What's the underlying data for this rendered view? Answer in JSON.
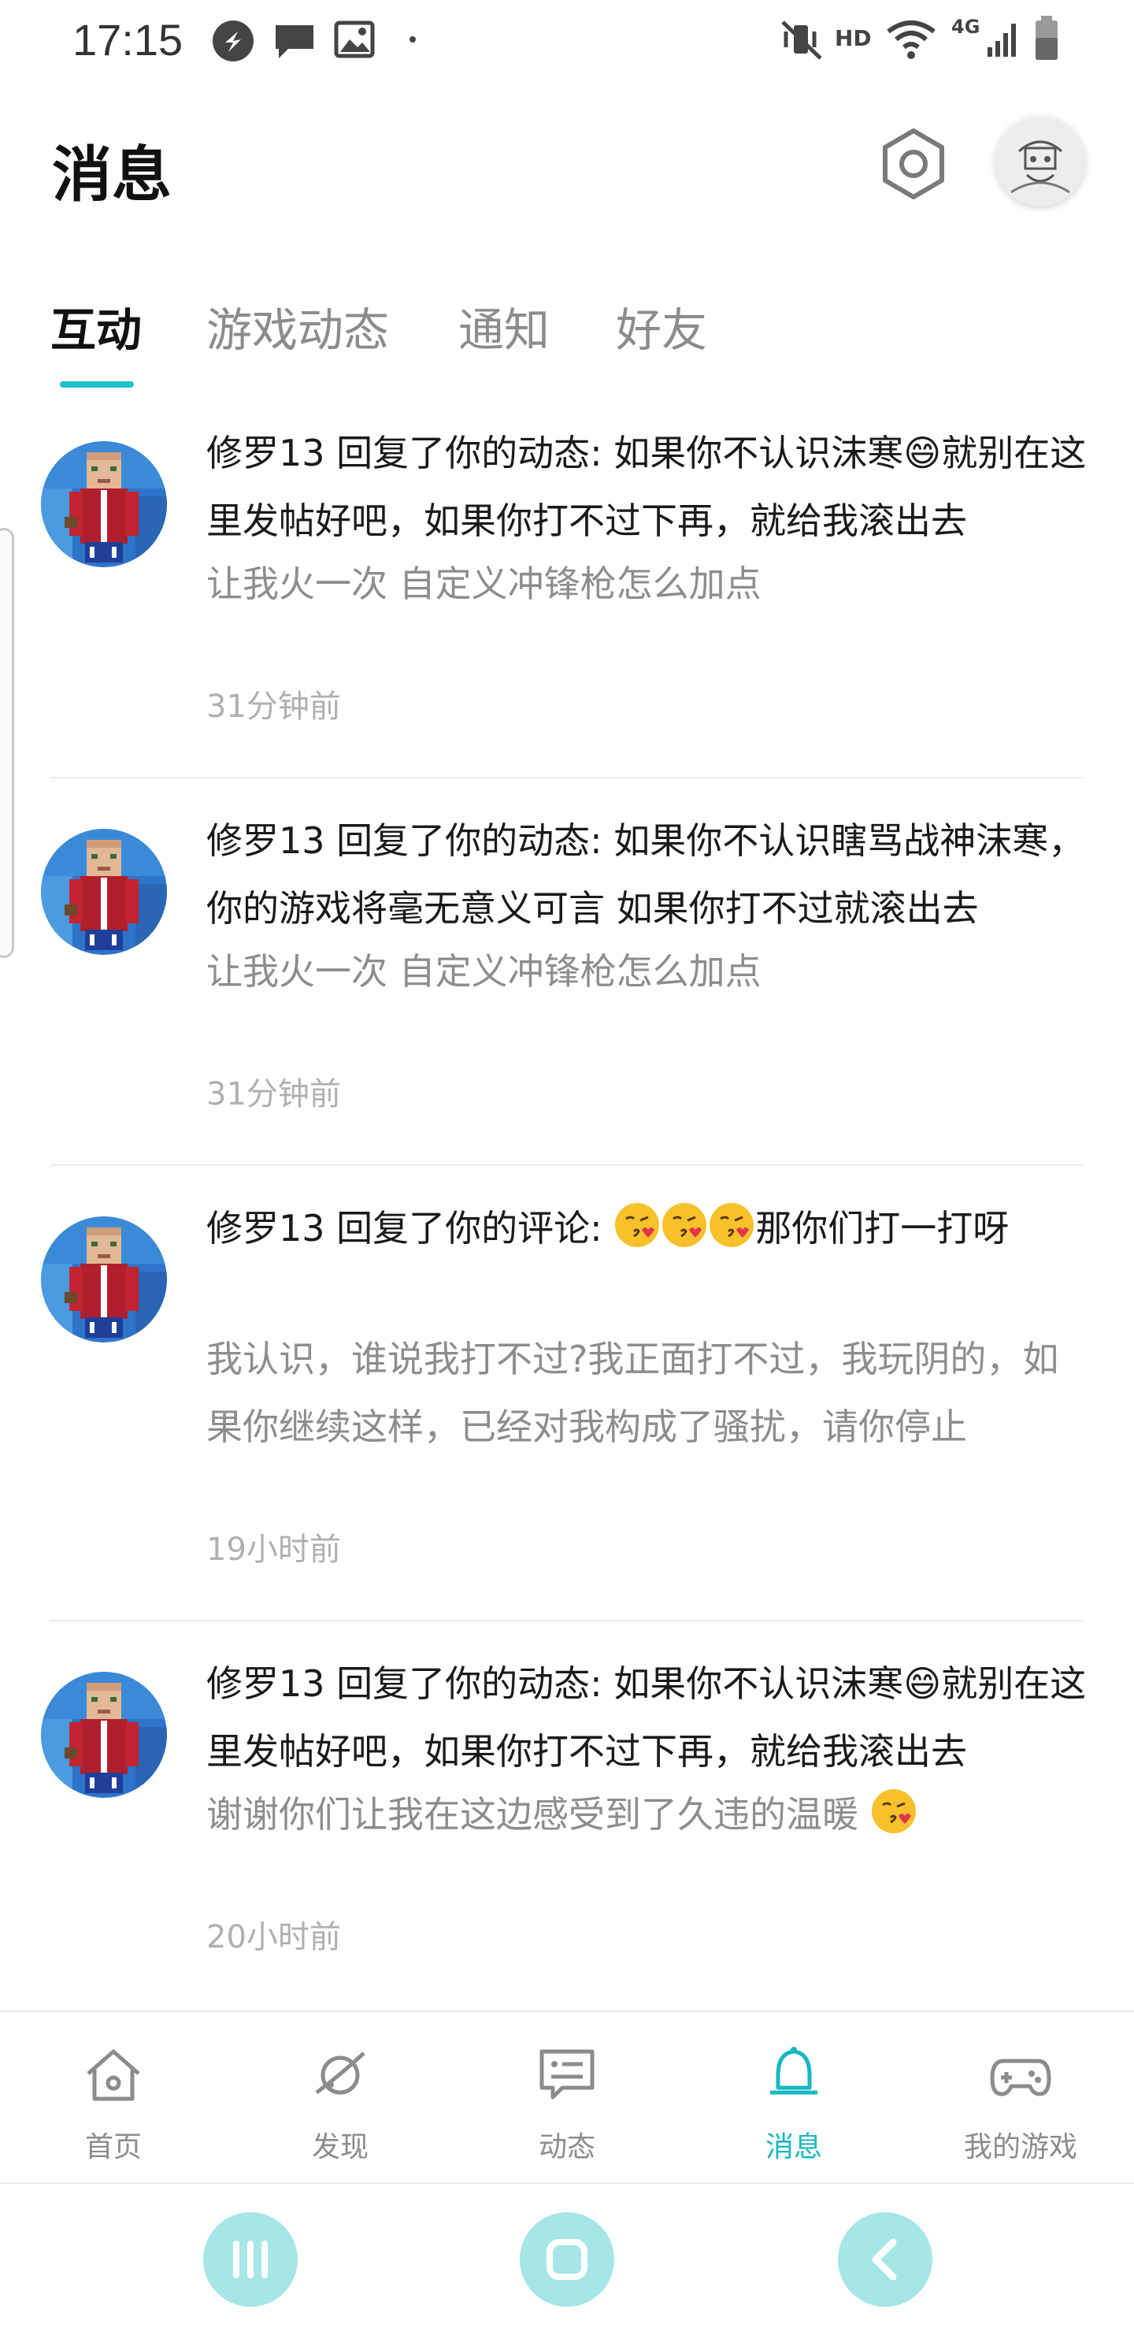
{
  "status_bar": {
    "time": "17:15",
    "hd_label": "HD",
    "network_label": "4G",
    "icons": [
      "app-notification-icon",
      "chat-notification-icon",
      "image-notification-icon",
      "dot-icon",
      "vibrate-mute-icon",
      "wifi-icon",
      "signal-icon",
      "battery-icon"
    ]
  },
  "header": {
    "title": "消息",
    "settings_icon": "hexagon-settings-icon",
    "avatar_icon": "user-avatar"
  },
  "tabs": [
    {
      "label": "互动",
      "active": true
    },
    {
      "label": "游戏动态",
      "active": false
    },
    {
      "label": "通知",
      "active": false
    },
    {
      "label": "好友",
      "active": false
    }
  ],
  "accent_color": "#1cc2c9",
  "messages": [
    {
      "title": "修罗13 回复了你的动态: 如果你不认识沫寒😄就别在这里发帖好吧，如果你打不过下再，就给我滚出去",
      "quote": "让我火一次 自定义冲锋枪怎么加点",
      "time": "31分钟前"
    },
    {
      "title": "修罗13 回复了你的动态: 如果你不认识瞎骂战神沫寒，你的游戏将毫无意义可言 如果你打不过就滚出去",
      "quote": "让我火一次 自定义冲锋枪怎么加点",
      "time": "31分钟前"
    },
    {
      "title_prefix": "修罗13 回复了你的评论: ",
      "title_suffix": "那你们打一打呀",
      "quote": "我认识，谁说我打不过?我正面打不过，我玩阴的，如果你继续这样，已经对我构成了骚扰，请你停止",
      "time": "19小时前"
    },
    {
      "title": "修罗13 回复了你的动态: 如果你不认识沫寒😄就别在这里发帖好吧，如果你打不过下再，就给我滚出去",
      "quote": "谢谢你们让我在这边感受到了久违的温暖 ",
      "time": "20小时前"
    }
  ],
  "bottom_nav": [
    {
      "label": "首页",
      "icon": "home-icon",
      "active": false
    },
    {
      "label": "发现",
      "icon": "planet-icon",
      "active": false
    },
    {
      "label": "动态",
      "icon": "feed-icon",
      "active": false
    },
    {
      "label": "消息",
      "icon": "bell-icon",
      "active": true
    },
    {
      "label": "我的游戏",
      "icon": "gamepad-icon",
      "active": false
    }
  ],
  "system_nav": [
    "recent-apps-icon",
    "home-button-icon",
    "back-icon"
  ]
}
